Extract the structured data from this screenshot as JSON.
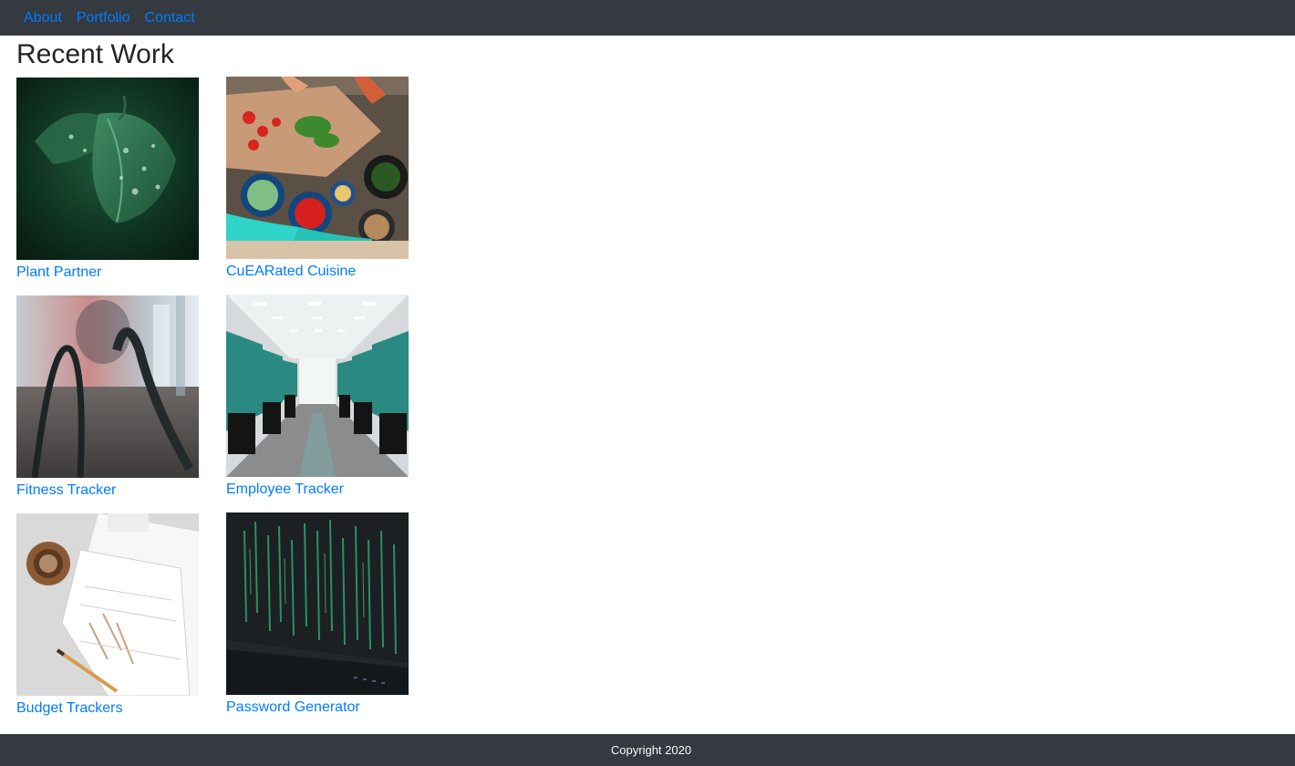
{
  "nav": {
    "items": [
      {
        "label": "About"
      },
      {
        "label": "Portfolio"
      },
      {
        "label": "Contact"
      }
    ]
  },
  "page": {
    "title": "Recent Work"
  },
  "projects": [
    {
      "title": "Plant Partner",
      "image": "leaf-with-water-drops"
    },
    {
      "title": "CuEARated Cuisine",
      "image": "cooking-ingredients"
    },
    {
      "title": "Fitness Tracker",
      "image": "battle-rope-gym"
    },
    {
      "title": "Employee Tracker",
      "image": "empty-office-cubicles"
    },
    {
      "title": "Budget Trackers",
      "image": "papers-and-pencil"
    },
    {
      "title": "Password Generator",
      "image": "green-code-screen"
    }
  ],
  "footer": {
    "copyright": "Copyright 2020"
  },
  "colors": {
    "nav_bg": "#343a40",
    "link": "#007bff",
    "footer_text": "#f8f9fa"
  }
}
